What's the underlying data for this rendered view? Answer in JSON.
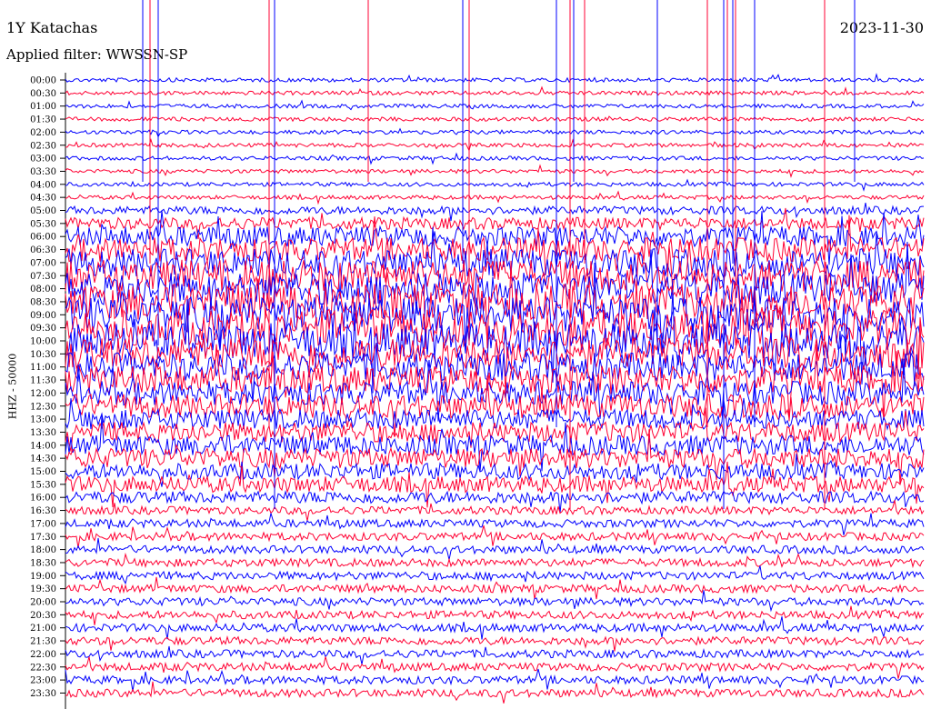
{
  "header": {
    "station": "1Y Katachas",
    "date": "2023-11-30",
    "filter": "Applied filter: WWSSN-SP"
  },
  "colors": {
    "even": "#0000ff",
    "odd": "#ff0033"
  },
  "chart_data": {
    "type": "line",
    "title": "1Y Katachas",
    "ylabel": "HHZ - 50000",
    "xlabel": "",
    "row_labels": [
      "00:00",
      "00:30",
      "01:00",
      "01:30",
      "02:00",
      "02:30",
      "03:00",
      "03:30",
      "04:00",
      "04:30",
      "05:00",
      "05:30",
      "06:00",
      "06:30",
      "07:00",
      "07:30",
      "08:00",
      "08:30",
      "09:00",
      "09:30",
      "10:00",
      "10:30",
      "11:00",
      "11:30",
      "12:00",
      "12:30",
      "13:00",
      "13:30",
      "14:00",
      "14:30",
      "15:00",
      "15:30",
      "16:00",
      "16:30",
      "17:00",
      "17:30",
      "18:00",
      "18:30",
      "19:00",
      "19:30",
      "20:00",
      "20:30",
      "21:00",
      "21:30",
      "22:00",
      "22:30",
      "23:00",
      "23:30"
    ],
    "series": [
      {
        "values": [
          1,
          1,
          1,
          1,
          1,
          1,
          1,
          1,
          1,
          1,
          2,
          3,
          5,
          6,
          7,
          8,
          8,
          9,
          9,
          9,
          9,
          8,
          7,
          7,
          6,
          6,
          5,
          5,
          5,
          5,
          4,
          4,
          3,
          2,
          2,
          2,
          2,
          2,
          2,
          2,
          2,
          2,
          2,
          2,
          2,
          2,
          2,
          2
        ]
      }
    ]
  }
}
